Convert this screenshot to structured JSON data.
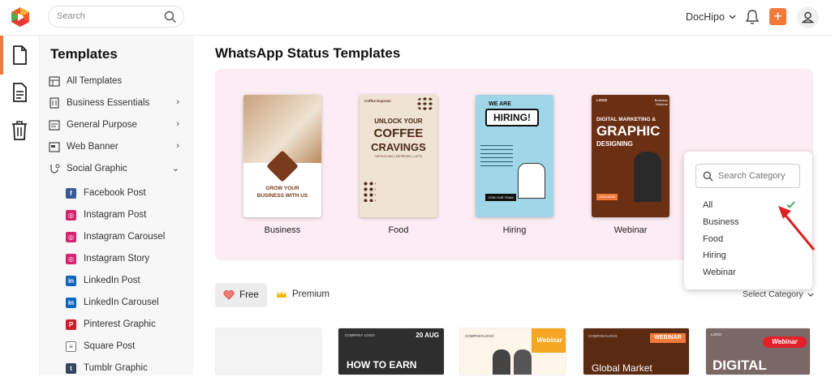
{
  "search": {
    "placeholder": "Search"
  },
  "header": {
    "account_name": "DocHipo",
    "plus_label": "+"
  },
  "sidebar": {
    "title": "Templates",
    "items": [
      {
        "label": "All Templates",
        "icon": "grid-icon",
        "chevron": ""
      },
      {
        "label": "Business Essentials",
        "icon": "building-icon",
        "chevron": "›"
      },
      {
        "label": "General Purpose",
        "icon": "doc-list-icon",
        "chevron": "›"
      },
      {
        "label": "Web Banner",
        "icon": "banner-icon",
        "chevron": "›"
      },
      {
        "label": "Social Graphic",
        "icon": "social-icon",
        "chevron": "⌄"
      }
    ],
    "subitems": [
      {
        "label": "Facebook Post",
        "icon_text": "f",
        "color": "#3b5998"
      },
      {
        "label": "Instagram Post",
        "icon_text": "◎",
        "color": "#d6246e"
      },
      {
        "label": "Instagram Carousel",
        "icon_text": "◎",
        "color": "#d6246e"
      },
      {
        "label": "Instagram Story",
        "icon_text": "◎",
        "color": "#d6246e"
      },
      {
        "label": "LinkedIn Post",
        "icon_text": "in",
        "color": "#0a66c2"
      },
      {
        "label": "LinkedIn Carousel",
        "icon_text": "in",
        "color": "#0a66c2"
      },
      {
        "label": "Pinterest Graphic",
        "icon_text": "P",
        "color": "#cb1f27"
      },
      {
        "label": "Square Post",
        "icon_text": "≡",
        "color": "#777777"
      },
      {
        "label": "Tumblr Graphic",
        "icon_text": "t",
        "color": "#34465d"
      }
    ]
  },
  "main": {
    "title": "WhatsApp Status Templates",
    "categories": [
      {
        "label": "Business",
        "card": {
          "line1": "GROW YOUR",
          "line2": "BUSINESS WITH US"
        }
      },
      {
        "label": "Food",
        "card": {
          "brand": "Coffee Express",
          "line1": "UNLOCK YOUR",
          "line2": "COFFEE",
          "line3": "CRAVINGS",
          "tag": "CAPPUCCINO | ESPRESSO | LATTE"
        }
      },
      {
        "label": "Hiring",
        "card": {
          "line1": "WE ARE",
          "line2": "HIRING!",
          "cta": "JOIN OUR TEAM"
        }
      },
      {
        "label": "Webinar",
        "card": {
          "logo": "LOGO",
          "kicker": "Business Webinar",
          "line1": "DIGITAL MARKETING &",
          "line2": "GRAPHIC",
          "line3": "DESIGNING",
          "cta": "JOIN NOW"
        }
      }
    ],
    "free_label": "Free",
    "premium_label": "Premium",
    "select_category_label": "Select Category",
    "thumbs": [
      {
        "title": "",
        "top": "",
        "bg": "#f0f0f0"
      },
      {
        "title": "HOW TO EARN",
        "top": "20 AUG",
        "bg": "#2e2e2e"
      },
      {
        "title": "",
        "top": "Webinar",
        "bg": "#fff6ea"
      },
      {
        "title": "Global Market",
        "top": "WEBINAR",
        "bg": "#5b2a12"
      },
      {
        "title": "DIGITAL",
        "top": "Webinar",
        "bg": "#7a6866"
      }
    ]
  },
  "dropdown": {
    "placeholder": "Search Category",
    "options": [
      "All",
      "Business",
      "Food",
      "Hiring",
      "Webinar"
    ],
    "selected": "All"
  }
}
